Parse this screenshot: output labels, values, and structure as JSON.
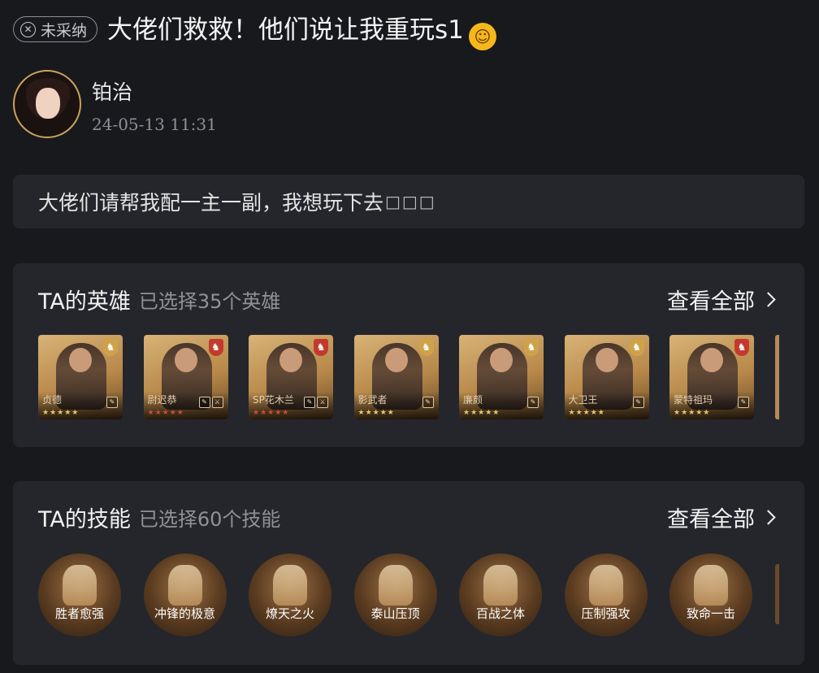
{
  "post": {
    "status_badge": "未采纳",
    "title": "大佬们救救！他们说让我重玩s1",
    "emoji": "rolling-on-floor-laughing",
    "author": "铂治",
    "time": "24-05-13 11:31",
    "content": "大佬们请帮我配一主一副，我想玩下去",
    "content_missing_glyphs": "□□□"
  },
  "heroes_panel": {
    "title": "TA的英雄",
    "subtitle": "已选择35个英雄",
    "view_all": "查看全部",
    "items": [
      {
        "name": "贞德",
        "emblem": "gold",
        "stars": "★★★★★",
        "star_color": "#e7c56f",
        "badges": [
          "✎"
        ]
      },
      {
        "name": "尉迟恭",
        "emblem": "red",
        "stars": "★★★★★",
        "star_color": "#d04a3a",
        "badges": [
          "✎",
          "⚔"
        ]
      },
      {
        "name": "SP花木兰",
        "emblem": "red",
        "stars": "★★★★★",
        "star_color": "#d04a3a",
        "badges": [
          "✎",
          "⚔"
        ]
      },
      {
        "name": "影武者",
        "emblem": "gold",
        "stars": "★★★★★",
        "star_color": "#e7c56f",
        "badges": [
          "✎"
        ]
      },
      {
        "name": "廉颇",
        "emblem": "gold",
        "stars": "★★★★★",
        "star_color": "#e7c56f",
        "badges": [
          "✎"
        ]
      },
      {
        "name": "大卫王",
        "emblem": "gold",
        "stars": "★★★★★",
        "star_color": "#e7c56f",
        "badges": [
          "✎"
        ]
      },
      {
        "name": "蒙特祖玛",
        "emblem": "red",
        "stars": "★★★★★",
        "star_color": "#e7c56f",
        "badges": [
          "✎"
        ]
      }
    ]
  },
  "skills_panel": {
    "title": "TA的技能",
    "subtitle": "已选择60个技能",
    "view_all": "查看全部",
    "items": [
      "胜者愈强",
      "冲锋的极意",
      "燎天之火",
      "泰山压顶",
      "百战之体",
      "压制强攻",
      "致命一击"
    ]
  }
}
